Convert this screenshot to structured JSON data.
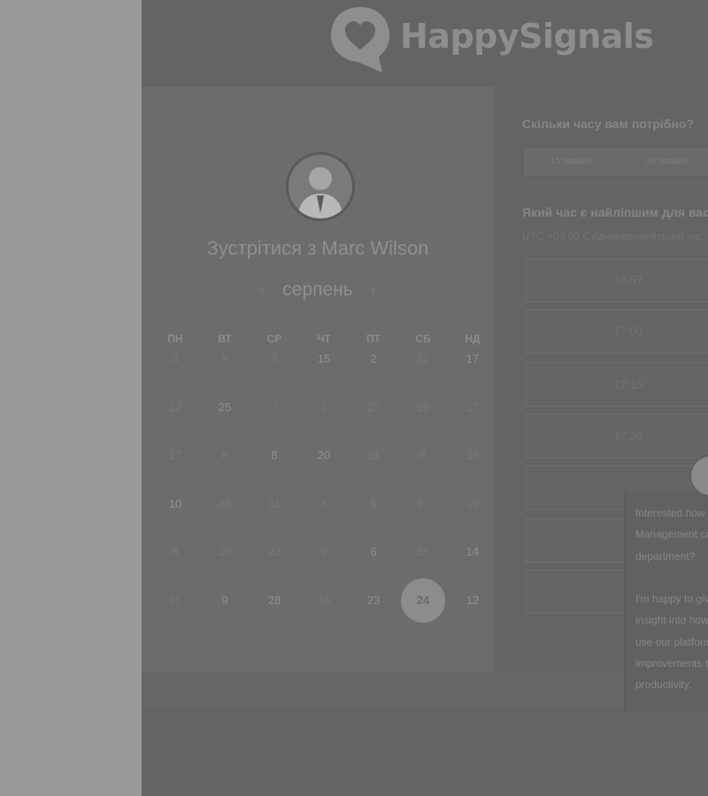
{
  "brand": {
    "name": "HappySignals"
  },
  "calendar": {
    "title": "Зустрітися з Marc Wilson",
    "month": "серпень",
    "weekdays": [
      "ПН",
      "ВТ",
      "СР",
      "ЧТ",
      "ПТ",
      "СБ",
      "НД"
    ],
    "days": [
      {
        "d": "4",
        "a": false
      },
      {
        "d": "9",
        "a": false
      },
      {
        "d": "3",
        "a": false
      },
      {
        "d": "15",
        "a": true
      },
      {
        "d": "2",
        "a": true
      },
      {
        "d": "31",
        "a": false
      },
      {
        "d": "17",
        "a": true
      },
      {
        "d": "22",
        "a": false
      },
      {
        "d": "25",
        "a": true
      },
      {
        "d": "7",
        "a": false
      },
      {
        "d": "2",
        "a": false
      },
      {
        "d": "27",
        "a": false
      },
      {
        "d": "29",
        "a": false
      },
      {
        "d": "17",
        "a": false
      },
      {
        "d": "17",
        "a": false
      },
      {
        "d": "8",
        "a": false
      },
      {
        "d": "8",
        "a": true
      },
      {
        "d": "20",
        "a": true
      },
      {
        "d": "31",
        "a": false
      },
      {
        "d": "8",
        "a": false
      },
      {
        "d": "19",
        "a": false
      },
      {
        "d": "10",
        "a": true
      },
      {
        "d": "25",
        "a": false
      },
      {
        "d": "11",
        "a": false
      },
      {
        "d": "4",
        "a": false
      },
      {
        "d": "5",
        "a": false
      },
      {
        "d": "27",
        "a": false
      },
      {
        "d": "19",
        "a": false
      },
      {
        "d": "8",
        "a": false
      },
      {
        "d": "10",
        "a": false
      },
      {
        "d": "22",
        "a": false
      },
      {
        "d": "9",
        "a": false
      },
      {
        "d": "6",
        "a": true
      },
      {
        "d": "25",
        "a": false
      },
      {
        "d": "14",
        "a": true
      },
      {
        "d": "11",
        "a": false
      },
      {
        "d": "9",
        "a": true
      },
      {
        "d": "28",
        "a": true
      },
      {
        "d": "16",
        "a": false
      },
      {
        "d": "23",
        "a": true
      },
      {
        "d": "24",
        "a": true,
        "selected": true
      },
      {
        "d": "12",
        "a": true
      }
    ]
  },
  "scheduler": {
    "duration_question": "Скільки часу вам потрібно?",
    "durations": [
      "15 хвилин",
      "30 хвилин"
    ],
    "time_question": "Який час є найліпшим для вас?",
    "timezone": "UTC +03:00 Східноєвропейський час",
    "slots": [
      "16:57",
      "17:00",
      "17:15",
      "17:30",
      "",
      "",
      ""
    ]
  },
  "chat": {
    "lines": [
      "Interested how",
      "Management can",
      "department?",
      "",
      "I'm happy to give",
      "insight into how",
      "use our platform",
      "improvements to",
      "productivity."
    ]
  }
}
